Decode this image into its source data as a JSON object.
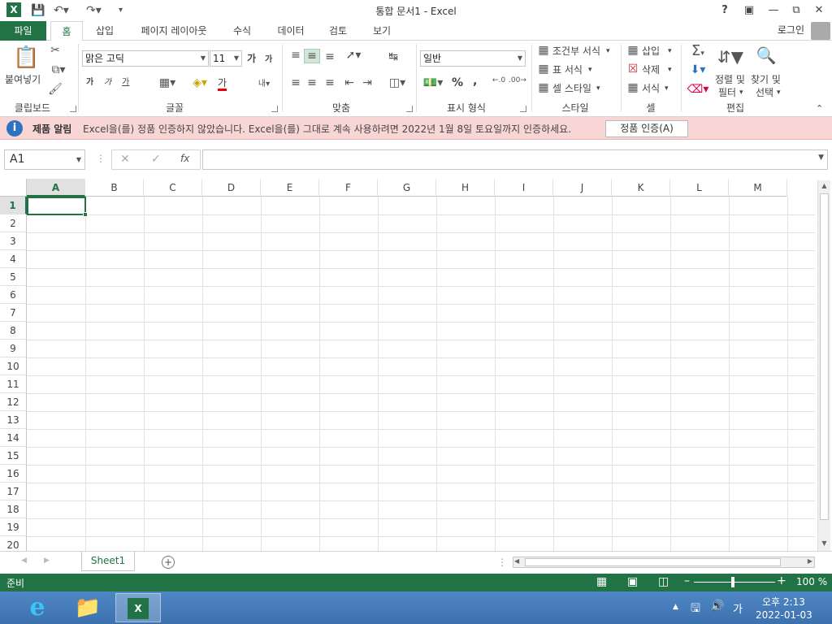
{
  "title_bar": {
    "window_title": "통합 문서1 - Excel",
    "app_letter": "X",
    "help": "?"
  },
  "tabs": {
    "file": "파일",
    "home": "홈",
    "insert": "삽입",
    "page_layout": "페이지 레이아웃",
    "formulas": "수식",
    "data": "데이터",
    "review": "검토",
    "view": "보기"
  },
  "account": {
    "login": "로그인"
  },
  "ribbon": {
    "clipboard": {
      "paste": "붙여넣기",
      "label": "클립보드"
    },
    "font": {
      "name": "맑은 고딕",
      "size": "11",
      "grow": "가",
      "shrink": "가",
      "bold": "가",
      "italic": "가",
      "underline": "가",
      "color_letter": "가",
      "label": "글꼴"
    },
    "alignment": {
      "label": "맞춤"
    },
    "number": {
      "format": "일반",
      "percent": "%",
      "comma": ",",
      "label": "표시 형식"
    },
    "styles": {
      "conditional": "조건부 서식",
      "table": "표 서식",
      "cell": "셀 스타일",
      "label": "스타일"
    },
    "cells": {
      "insert": "삽입",
      "delete": "삭제",
      "format": "서식",
      "label": "셀"
    },
    "editing": {
      "sort1": "정렬 및",
      "sort2": "필터",
      "find1": "찾기 및",
      "find2": "선택",
      "label": "편집"
    }
  },
  "notice": {
    "head": "제품 알림",
    "message": "Excel을(를) 정품 인증하지 않았습니다. Excel을(를) 그대로 계속 사용하려면 2022년 1월 8일 토요일까지 인증하세요.",
    "button": "정품 인증(A)"
  },
  "formula_bar": {
    "name_box": "A1",
    "fx": "fx"
  },
  "grid": {
    "columns": [
      "A",
      "B",
      "C",
      "D",
      "E",
      "F",
      "G",
      "H",
      "I",
      "J",
      "K",
      "L",
      "M"
    ],
    "rows": [
      "1",
      "2",
      "3",
      "4",
      "5",
      "6",
      "7",
      "8",
      "9",
      "10",
      "11",
      "12",
      "13",
      "14",
      "15",
      "16",
      "17",
      "18",
      "19",
      "20"
    ]
  },
  "sheets": {
    "active": "Sheet1"
  },
  "status": {
    "ready": "준비",
    "zoom": "100 %"
  },
  "taskbar": {
    "ime": "가",
    "time": "오후 2:13",
    "date": "2022-01-03"
  },
  "colors": {
    "accent": "#217346",
    "notice_bg": "#f9d6d6",
    "taskbar": "#4a80bd"
  }
}
